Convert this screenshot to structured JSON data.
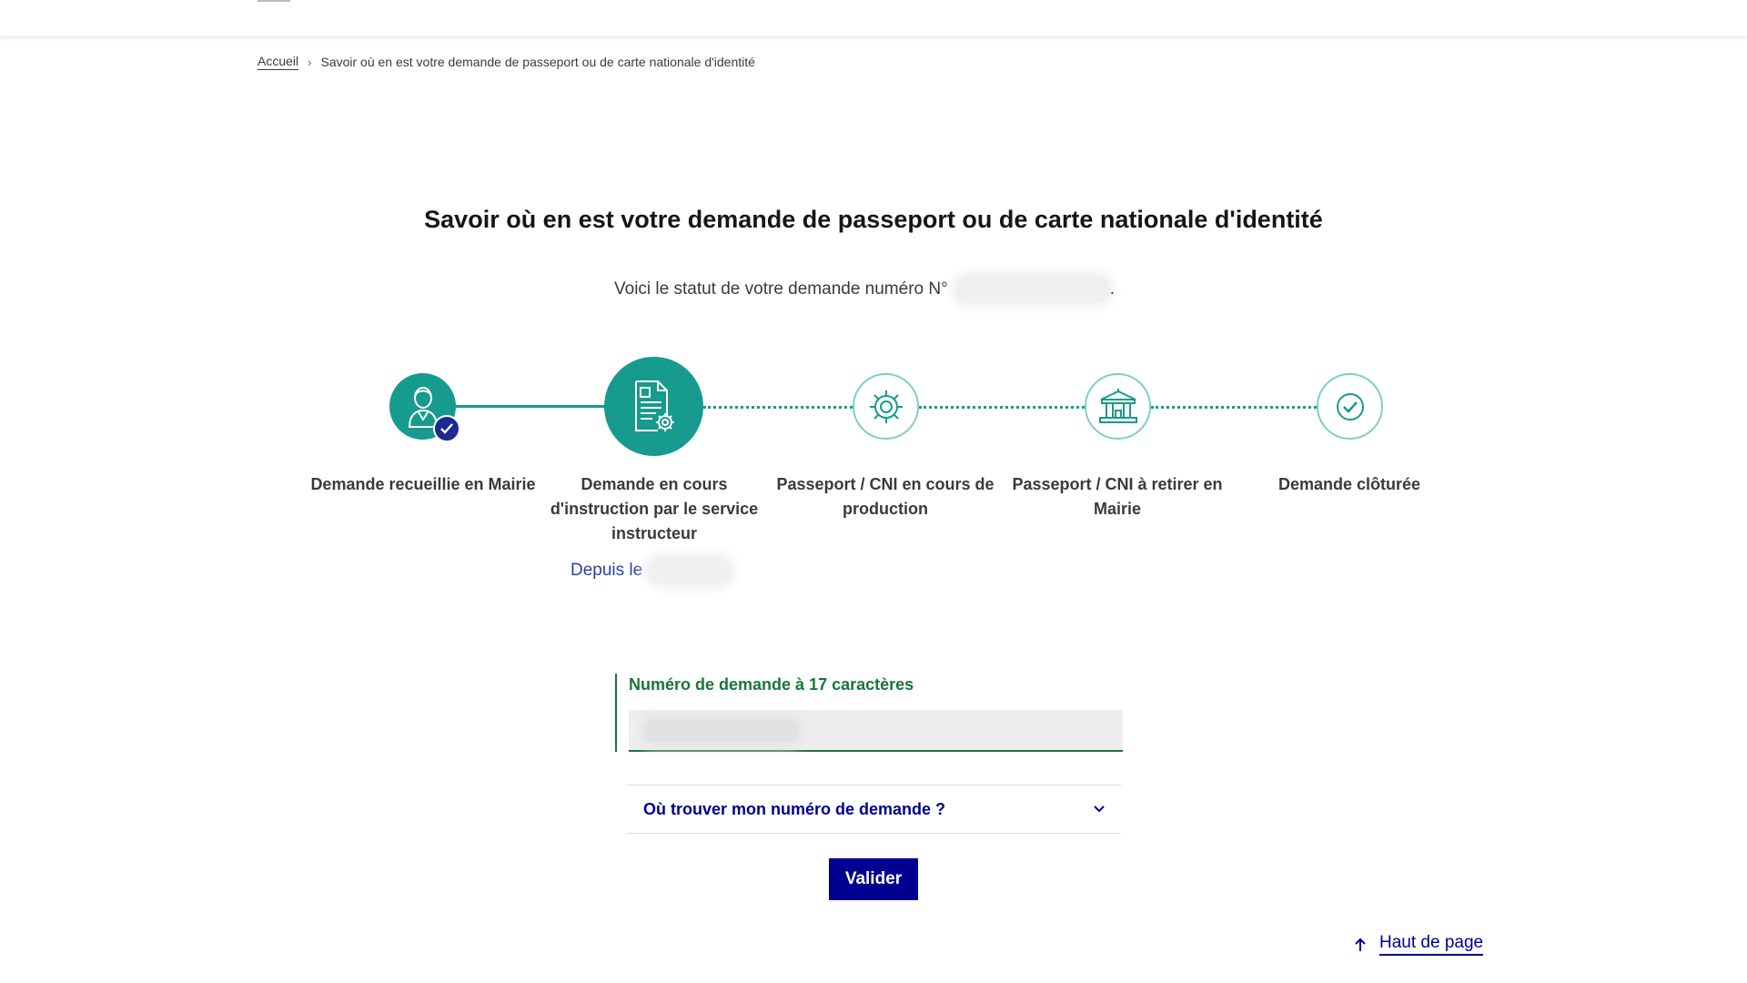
{
  "breadcrumb": {
    "home": "Accueil",
    "separator": "›",
    "current": "Savoir où en est votre demande de passeport ou de carte nationale d'identité"
  },
  "page": {
    "title": "Savoir où en est votre demande de passeport ou de carte nationale d'identité",
    "status_intro": "Voici le statut de votre demande numéro N°",
    "status_end": "."
  },
  "stepper": {
    "current_step": 2,
    "total_steps": 5,
    "steps": [
      {
        "label": "Demande recueillie en Mairie",
        "state": "done",
        "icon": "person-icon"
      },
      {
        "label": "Demande en cours d'instruction par le service instructeur",
        "state": "current",
        "icon": "document-gear-icon"
      },
      {
        "label": "Passeport / CNI en cours de production",
        "state": "todo",
        "icon": "gear-icon"
      },
      {
        "label": "Passeport / CNI à retirer en Mairie",
        "state": "todo",
        "icon": "town-hall-icon"
      },
      {
        "label": "Demande clôturée",
        "state": "todo",
        "icon": "check-circle-icon"
      }
    ],
    "since_label": "Depuis le"
  },
  "form": {
    "field_label": "Numéro de demande à 17 caractères",
    "accordion_label": "Où trouver mon numéro de demande ?",
    "submit_label": "Valider"
  },
  "footer": {
    "back_to_top": "Haut de page"
  },
  "colors": {
    "teal": "#169b8e",
    "navy": "#000091",
    "green": "#18753c",
    "badge": "#1e2a8f"
  }
}
